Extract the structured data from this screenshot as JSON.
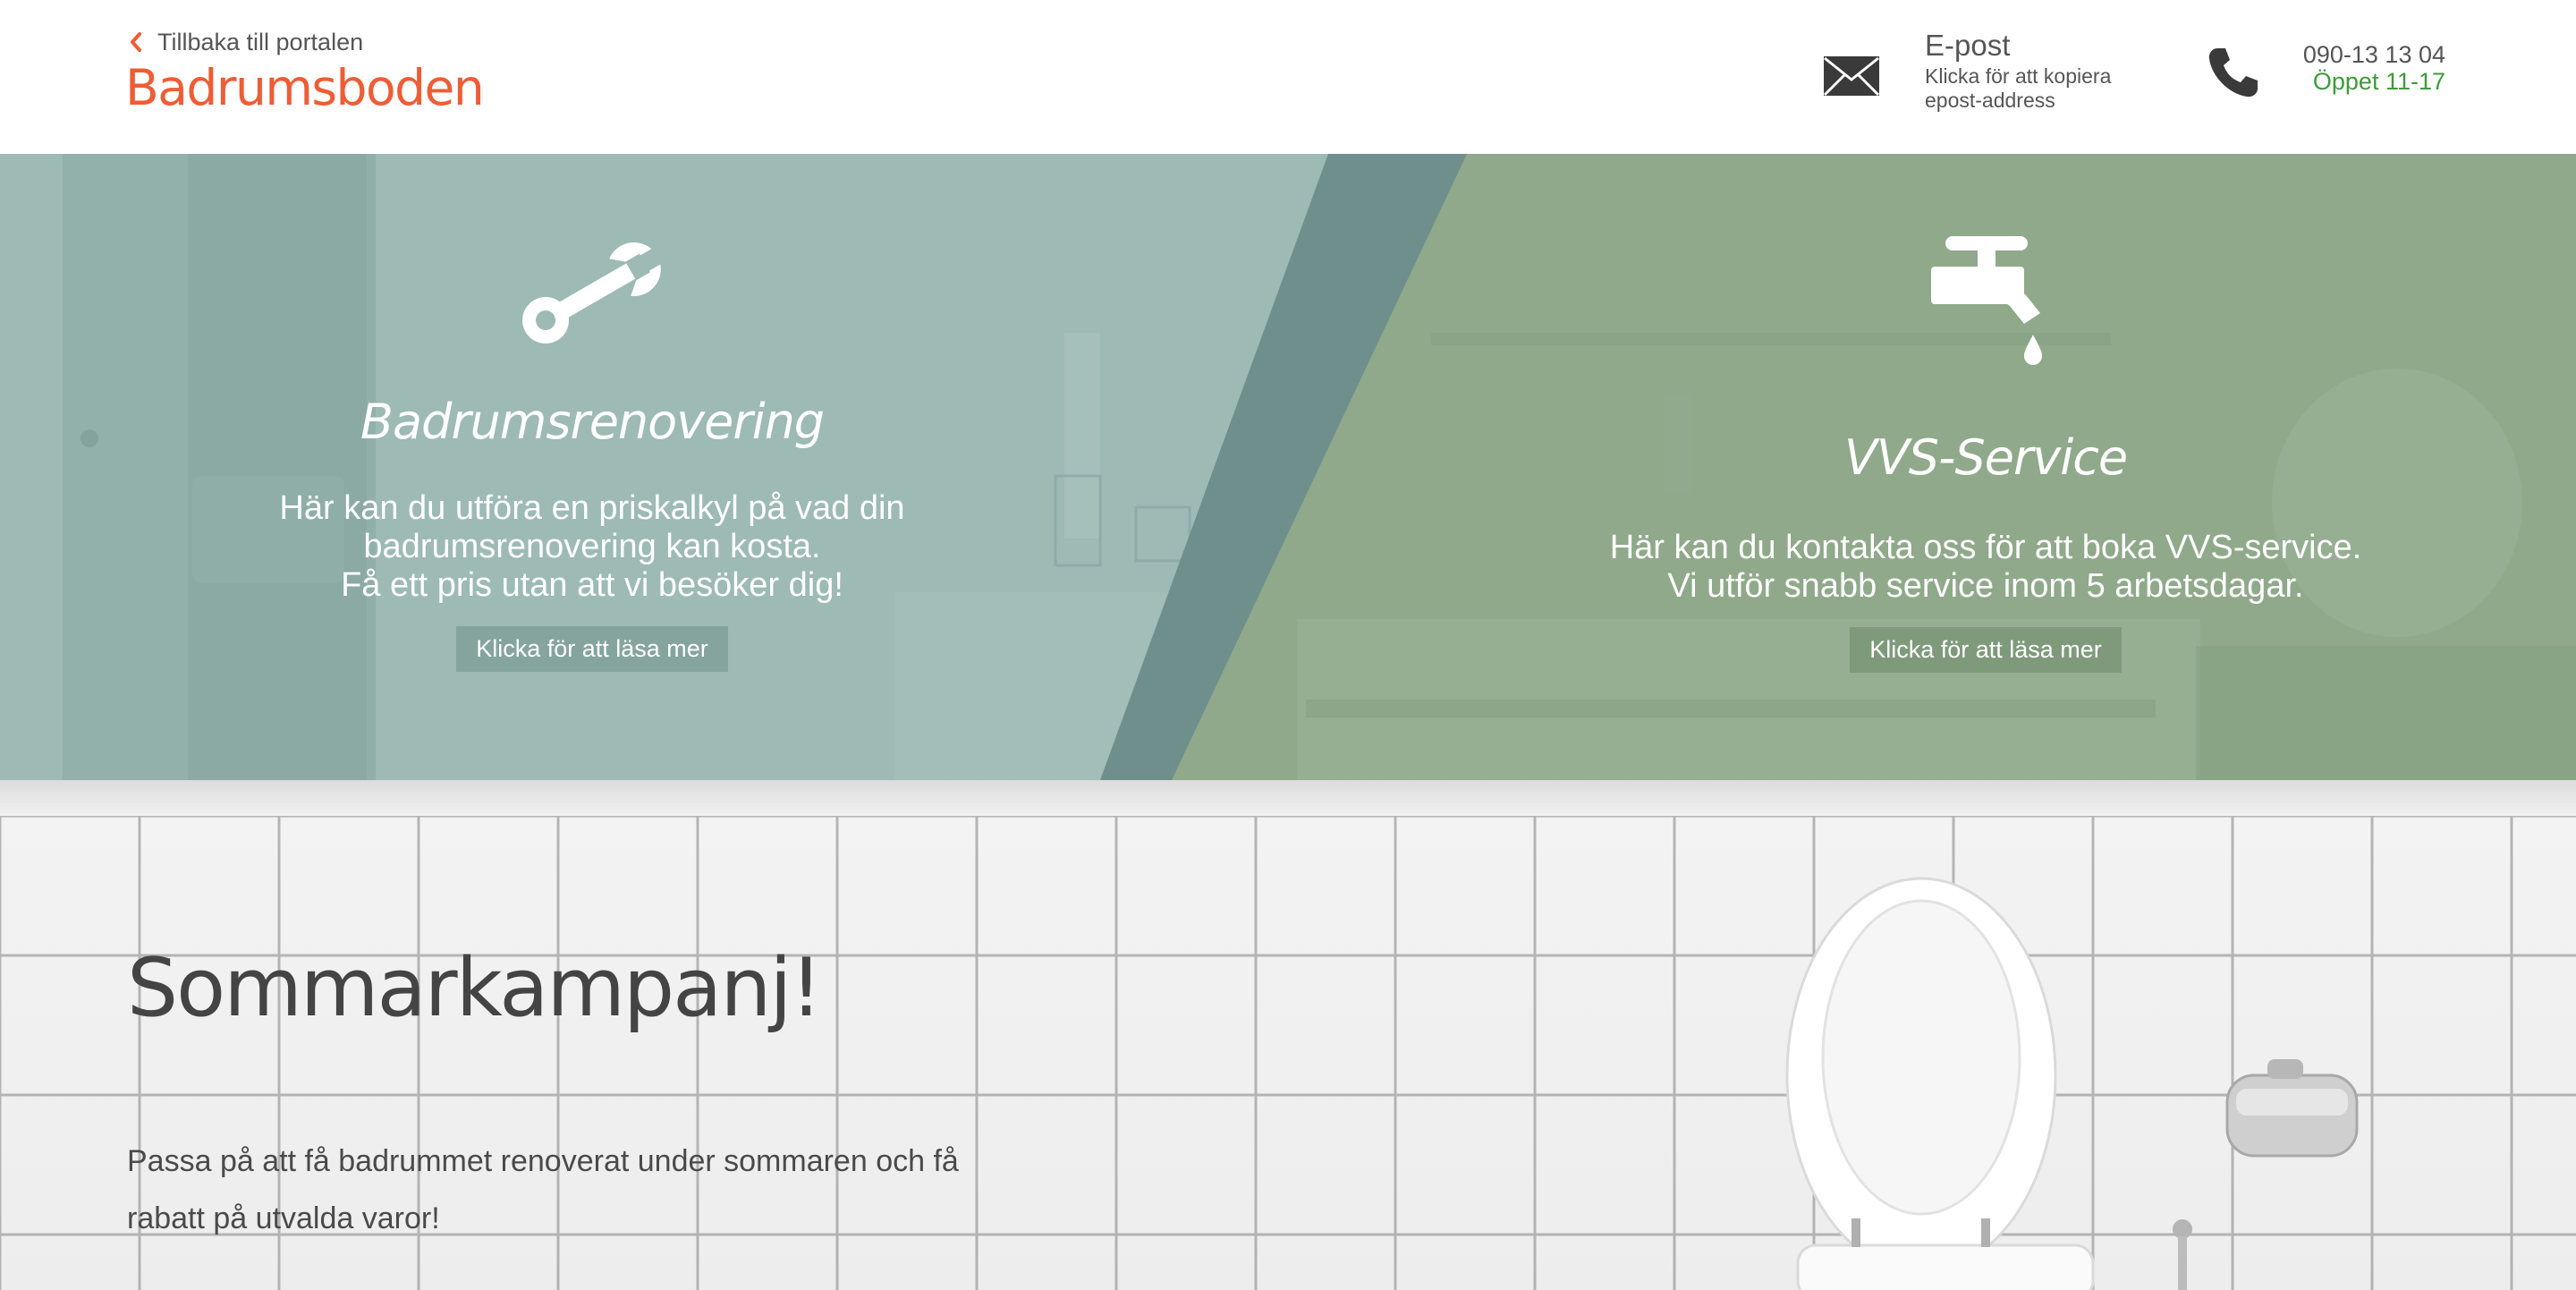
{
  "header": {
    "back_label": "Tillbaka till portalen",
    "brand": "Badrumsboden",
    "email": {
      "title": "E-post",
      "subtitle": "Klicka för att kopiera epost-address",
      "icon": "envelope-icon"
    },
    "phone": {
      "number": "090-13 13 04",
      "hours": "Öppet 11-17",
      "icon": "phone-icon"
    }
  },
  "hero": {
    "left": {
      "icon": "wrench-icon",
      "title": "Badrumsrenovering",
      "text_lines": [
        "Här kan du utföra en priskalkyl på vad din",
        "badrumsrenovering kan kosta.",
        "Få ett pris utan att vi besöker dig!"
      ],
      "button": "Klicka för att läsa mer"
    },
    "right": {
      "icon": "faucet-icon",
      "title": "VVS-Service",
      "text_lines": [
        "Här kan du kontakta oss för att boka VVS-service.",
        "Vi utför snabb service inom 5 arbetsdagar."
      ],
      "button": "Klicka för att läsa mer"
    }
  },
  "promo": {
    "title": "Sommarkampanj!",
    "text_lines": [
      "Passa på att få badrummet renoverat under sommaren och få",
      "rabatt på utvalda varor!"
    ]
  },
  "colors": {
    "brand": "#ee5d35",
    "hours_green": "#3e9a3a",
    "hero_left": "#94b5ad",
    "hero_right": "#8da98a",
    "hero_divider": "#6f8f8c"
  }
}
